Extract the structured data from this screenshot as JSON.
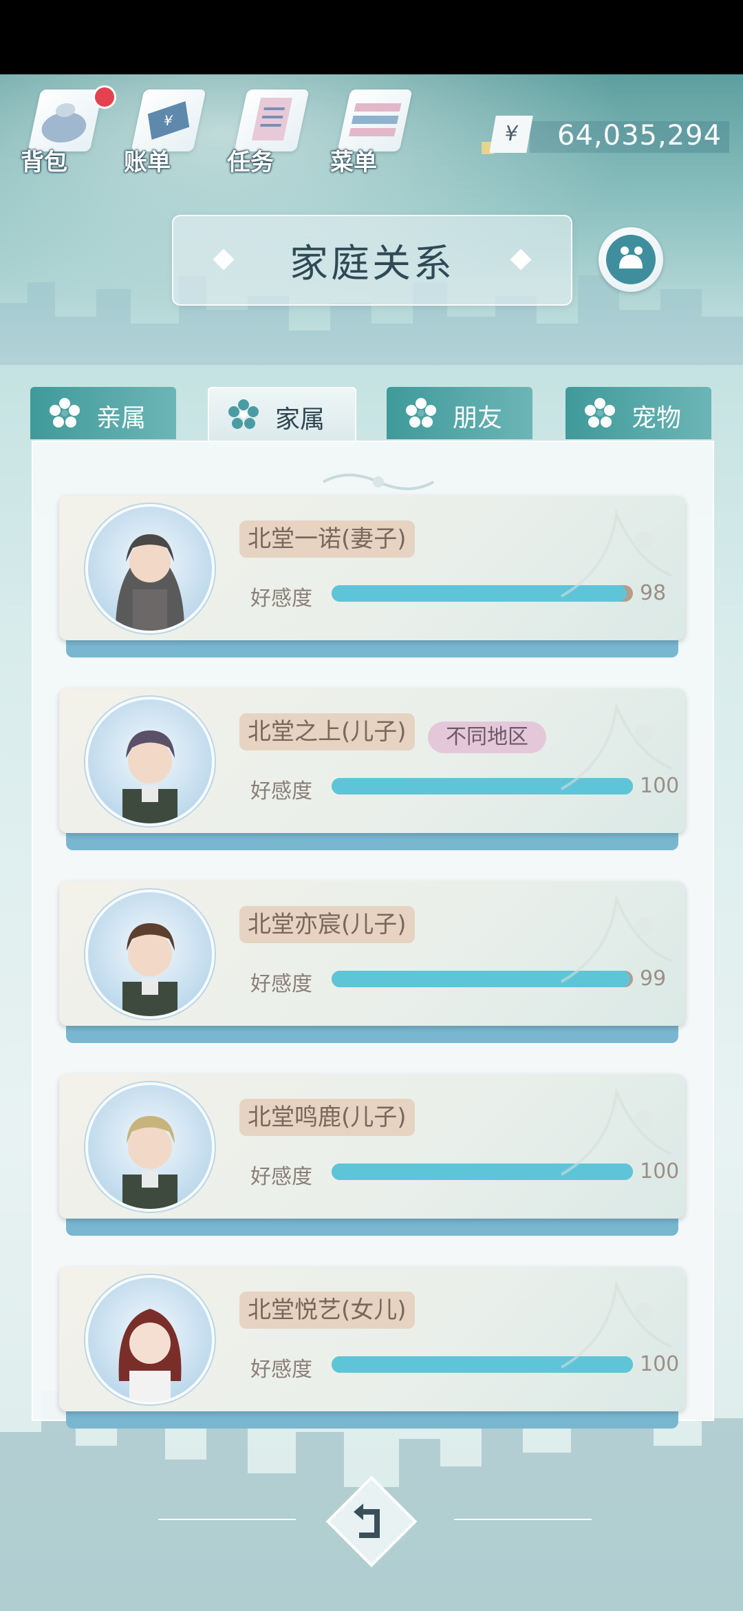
{
  "top_bar": {
    "buttons": [
      {
        "label": "背包",
        "icon": "backpack-icon",
        "has_notification": true
      },
      {
        "label": "账单",
        "icon": "bill-icon"
      },
      {
        "label": "任务",
        "icon": "task-icon"
      },
      {
        "label": "菜单",
        "icon": "menu-icon"
      }
    ],
    "currency_symbol": "¥",
    "money": "64,035,294"
  },
  "title": "家庭关系",
  "tabs": [
    {
      "label": "亲属",
      "active": false
    },
    {
      "label": "家属",
      "active": true
    },
    {
      "label": "朋友",
      "active": false
    },
    {
      "label": "宠物",
      "active": false
    }
  ],
  "favor_label": "好感度",
  "members": [
    {
      "name": "北堂一诺(妻子)",
      "favor": 98,
      "badge": ""
    },
    {
      "name": "北堂之上(儿子)",
      "favor": 100,
      "badge": "不同地区"
    },
    {
      "name": "北堂亦宸(儿子)",
      "favor": 99,
      "badge": ""
    },
    {
      "name": "北堂鸣鹿(儿子)",
      "favor": 100,
      "badge": ""
    },
    {
      "name": "北堂悦艺(女儿)",
      "favor": 100,
      "badge": ""
    }
  ],
  "colors": {
    "bar_fill": "#5ec5d8",
    "tab_bg": "#3f9a9a",
    "name_tag": "#e6d3c2",
    "badge": "#e5c7da"
  }
}
